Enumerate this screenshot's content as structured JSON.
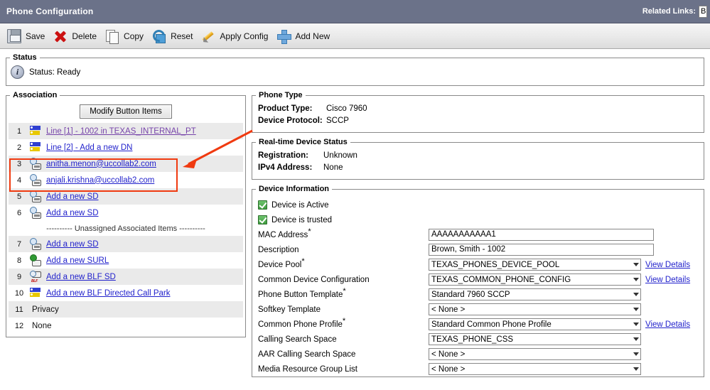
{
  "window": {
    "title": "Phone Configuration",
    "related_links_label": "Related Links:",
    "related_links_value": "B"
  },
  "toolbar": [
    {
      "label": "Save",
      "icon": "floppy-disk-icon"
    },
    {
      "label": "Delete",
      "icon": "red-x-icon"
    },
    {
      "label": "Copy",
      "icon": "copy-pages-icon"
    },
    {
      "label": "Reset",
      "icon": "reset-cube-icon"
    },
    {
      "label": "Apply Config",
      "icon": "pencil-icon"
    },
    {
      "label": "Add New",
      "icon": "blue-plus-icon"
    }
  ],
  "status": {
    "legend": "Status",
    "icon": "info-icon",
    "text": "Status: Ready"
  },
  "association": {
    "legend": "Association",
    "modify_button": "Modify Button Items",
    "separator": "---------- Unassigned Associated Items ----------",
    "rows": [
      {
        "index": "1",
        "label": "Line [1] - 1002 in TEXAS_INTERNAL_PT",
        "icon": "line-icon",
        "link": true,
        "visited": true
      },
      {
        "index": "2",
        "label": "Line [2] - Add a new DN",
        "icon": "line-icon",
        "link": true,
        "visited": false
      },
      {
        "index": "3",
        "label": "anitha.menon@uccollab2.com",
        "icon": "speed-dial-icon",
        "link": true,
        "visited": false
      },
      {
        "index": "4",
        "label": "anjali.krishna@uccollab2.com",
        "icon": "speed-dial-icon",
        "link": true,
        "visited": false
      },
      {
        "index": "5",
        "label": "Add a new SD",
        "icon": "speed-dial-icon",
        "link": true,
        "visited": false
      },
      {
        "index": "6",
        "label": "Add a new SD",
        "icon": "speed-dial-icon",
        "link": true,
        "visited": false
      }
    ],
    "rows_unassigned": [
      {
        "index": "7",
        "label": "Add a new SD",
        "icon": "speed-dial-icon",
        "link": true,
        "visited": false
      },
      {
        "index": "8",
        "label": "Add a new SURL",
        "icon": "surl-icon",
        "link": true,
        "visited": false
      },
      {
        "index": "9",
        "label": "Add a new BLF SD",
        "icon": "blf-sd-icon",
        "link": true,
        "visited": false
      },
      {
        "index": "10",
        "label": "Add a new BLF Directed Call Park",
        "icon": "line-icon",
        "link": true,
        "visited": false
      },
      {
        "index": "11",
        "label": "Privacy",
        "icon": "none",
        "link": false,
        "visited": false
      },
      {
        "index": "12",
        "label": "None",
        "icon": "none",
        "link": false,
        "visited": false
      }
    ]
  },
  "phone_type": {
    "legend": "Phone Type",
    "fields": [
      {
        "key": "Product Type:",
        "value": "Cisco 7960"
      },
      {
        "key": "Device Protocol:",
        "value": "SCCP"
      }
    ]
  },
  "realtime_status": {
    "legend": "Real-time Device Status",
    "fields": [
      {
        "key": "Registration:",
        "value": "Unknown"
      },
      {
        "key": "IPv4 Address:",
        "value": "None"
      }
    ]
  },
  "device_information": {
    "legend": "Device Information",
    "checkboxes": [
      {
        "label": "Device is Active",
        "checked": true
      },
      {
        "label": "Device is trusted",
        "checked": true
      }
    ],
    "fields": [
      {
        "label": "MAC Address",
        "required": true,
        "type": "text",
        "value": "AAAAAAAAAAA1",
        "view_details": false
      },
      {
        "label": "Description",
        "required": false,
        "type": "text",
        "value": "Brown, Smith - 1002",
        "view_details": false
      },
      {
        "label": "Device Pool",
        "required": true,
        "type": "select",
        "value": "TEXAS_PHONES_DEVICE_POOL",
        "view_details": true
      },
      {
        "label": "Common Device Configuration",
        "required": false,
        "type": "select",
        "value": "TEXAS_COMMON_PHONE_CONFIG",
        "view_details": true
      },
      {
        "label": "Phone Button Template",
        "required": true,
        "type": "select",
        "value": "Standard 7960 SCCP",
        "view_details": false
      },
      {
        "label": "Softkey Template",
        "required": false,
        "type": "select",
        "value": "< None >",
        "view_details": false
      },
      {
        "label": "Common Phone Profile",
        "required": true,
        "type": "select",
        "value": "Standard Common Phone Profile",
        "view_details": true
      },
      {
        "label": "Calling Search Space",
        "required": false,
        "type": "select",
        "value": "TEXAS_PHONE_CSS",
        "view_details": false
      },
      {
        "label": "AAR Calling Search Space",
        "required": false,
        "type": "select",
        "value": "< None >",
        "view_details": false
      },
      {
        "label": "Media Resource Group List",
        "required": false,
        "type": "select",
        "value": "< None >",
        "view_details": false
      }
    ],
    "view_details_label": "View Details"
  },
  "annotations": {
    "highlight_color": "#f03a10",
    "arrow_color": "#f03a10"
  }
}
